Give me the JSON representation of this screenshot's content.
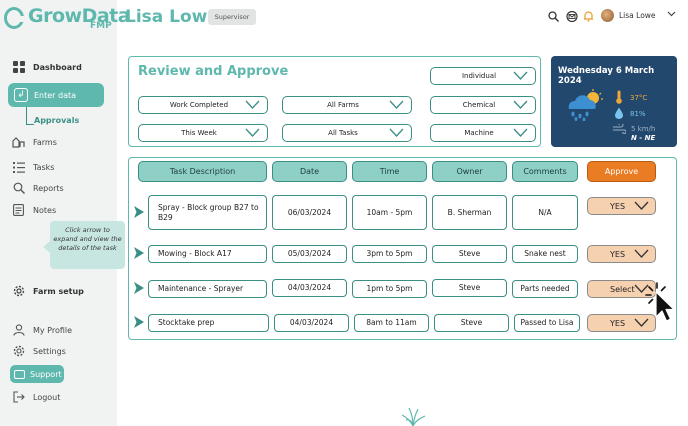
{
  "app": {
    "logo_text": "GrowData",
    "logo_sub": "FMP"
  },
  "header": {
    "user_title": "Lisa Lowe",
    "role": "Supervisor",
    "user_name": "Lisa Lowe",
    "icons": [
      "search-icon",
      "message-icon",
      "bell-icon",
      "chevron-down-icon"
    ]
  },
  "sidebar": {
    "dashboard": "Dashboard",
    "enter_data": "Enter data",
    "approvals": "Approvals",
    "farms": "Farms",
    "tasks": "Tasks",
    "reports": "Reports",
    "notes": "Notes",
    "farm_setup": "Farm setup",
    "my_profile": "My Profile",
    "settings": "Settings",
    "support": "Support",
    "logout": "Logout",
    "tooltip": "Click arrow to expand and view the details of the task"
  },
  "review": {
    "title": "Review and Approve",
    "filters": {
      "scope": "Individual",
      "status": "Work Completed",
      "farms": "All Farms",
      "category": "Chemical",
      "period": "This Week",
      "tasks": "All Tasks",
      "resource": "Machine"
    }
  },
  "weather": {
    "date": "Wednesday 6 March 2024",
    "temperature": "37°C",
    "humidity": "81%",
    "wind_speed": "5 km/h",
    "wind_direction": "N - NE",
    "colors": {
      "bg": "#23486d",
      "temp": "#f2a638",
      "humidity": "#79c4ec"
    }
  },
  "table": {
    "headers": {
      "task": "Task Description",
      "date": "Date",
      "time": "Time",
      "owner": "Owner",
      "comments": "Comments",
      "approve": "Approve"
    },
    "rows": [
      {
        "task": "Spray - Block group B27 to B29",
        "date": "06/03/2024",
        "time": "10am - 5pm",
        "owner": "B. Sherman",
        "comments": "N/A",
        "approve": "YES"
      },
      {
        "task": "Mowing - Block A17",
        "date": "05/03/2024",
        "time": "3pm to 5pm",
        "owner": "Steve",
        "comments": "Snake nest",
        "approve": "YES"
      },
      {
        "task": "Maintenance - Sprayer",
        "date": "04/03/2024",
        "time": "1pm to 5pm",
        "owner": "Steve",
        "comments": "Parts needed",
        "approve": "Select"
      },
      {
        "task": "Stocktake prep",
        "date": "04/03/2024",
        "time": "8am to 11am",
        "owner": "Steve",
        "comments": "Passed to Lisa",
        "approve": "YES"
      }
    ]
  },
  "colors": {
    "accent": "#5fb8ad",
    "accent_dark": "#3a8f85",
    "approve_header": "#ea7c24",
    "approve_cell": "#f6d1b0"
  }
}
